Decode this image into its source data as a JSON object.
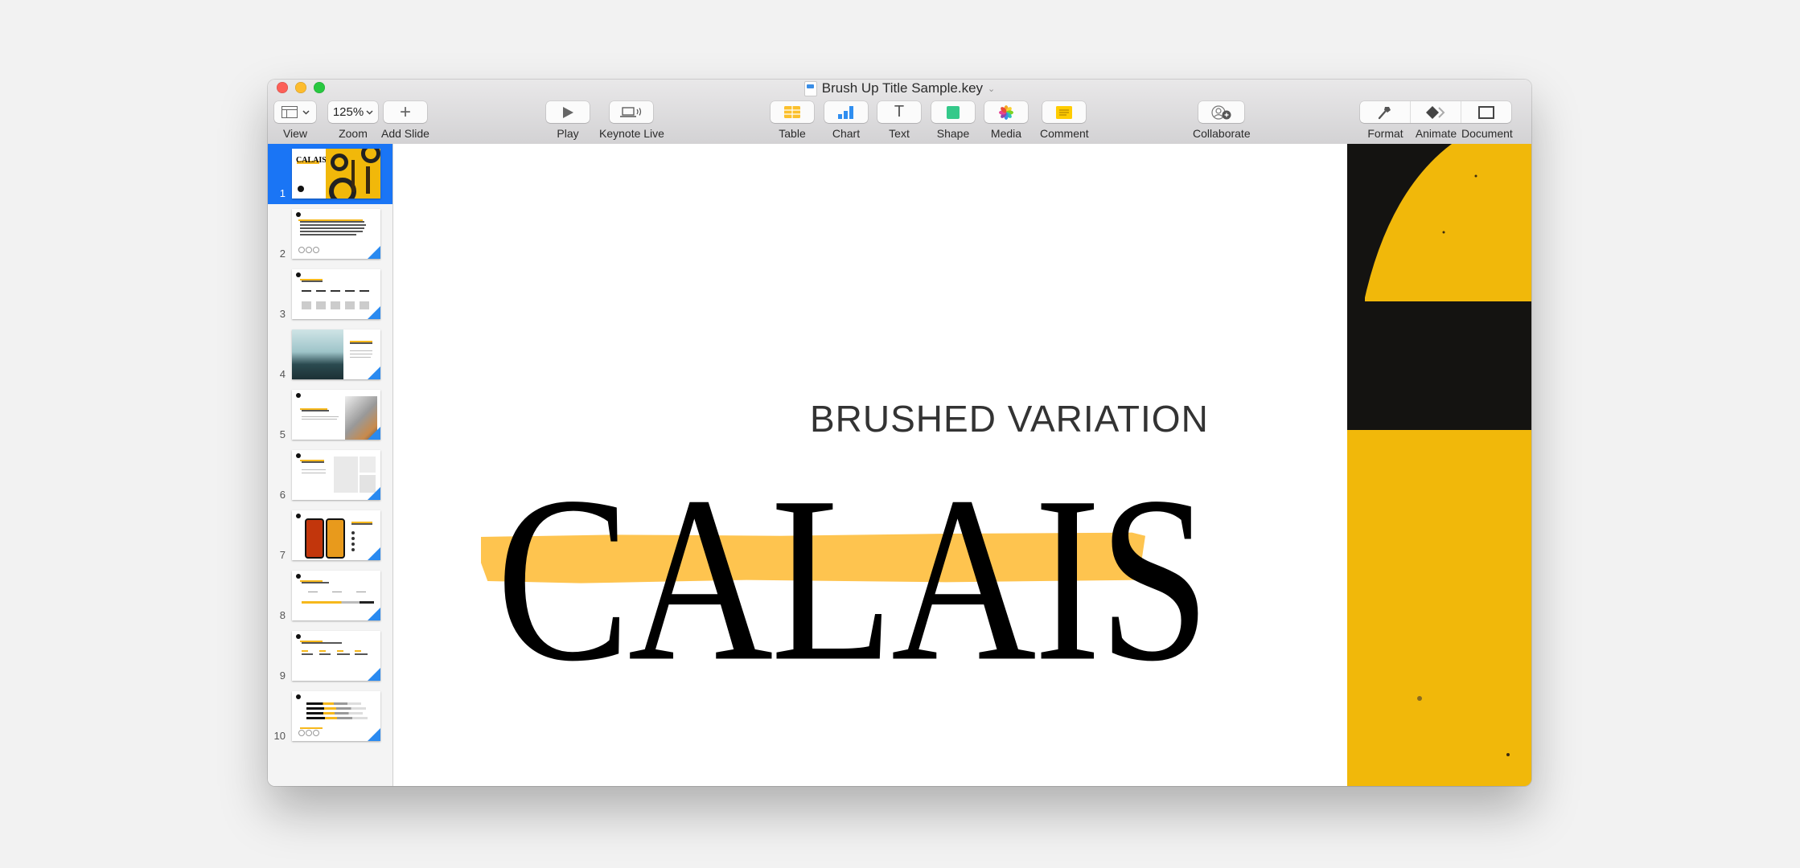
{
  "window": {
    "title": "Brush Up Title Sample.key",
    "title_chevron": "⌄"
  },
  "toolbar": {
    "view": {
      "label": "View",
      "icon": "sidebar-layout-icon"
    },
    "zoom": {
      "label": "Zoom",
      "value": "125%"
    },
    "add_slide": {
      "label": "Add Slide",
      "glyph": "+"
    },
    "play": {
      "label": "Play",
      "glyph": "▶"
    },
    "keynote_live": {
      "label": "Keynote Live"
    },
    "table": {
      "label": "Table"
    },
    "chart": {
      "label": "Chart"
    },
    "text": {
      "label": "Text",
      "glyph": "T"
    },
    "shape": {
      "label": "Shape"
    },
    "media": {
      "label": "Media"
    },
    "comment": {
      "label": "Comment"
    },
    "collaborate": {
      "label": "Collaborate"
    },
    "format": {
      "label": "Format"
    },
    "animate": {
      "label": "Animate"
    },
    "document": {
      "label": "Document"
    }
  },
  "sidebar": {
    "selected_index": 1,
    "slides": [
      {
        "number": "1",
        "thumb_title": "CALAIS"
      },
      {
        "number": "2"
      },
      {
        "number": "3"
      },
      {
        "number": "4"
      },
      {
        "number": "5"
      },
      {
        "number": "6"
      },
      {
        "number": "7"
      },
      {
        "number": "8"
      },
      {
        "number": "9"
      },
      {
        "number": "10"
      }
    ]
  },
  "slide": {
    "subtitle": "BRUSHED VARIATION",
    "title": "CALAIS",
    "accent_color": "#fec44f",
    "photo_color": "#f1b80a"
  }
}
